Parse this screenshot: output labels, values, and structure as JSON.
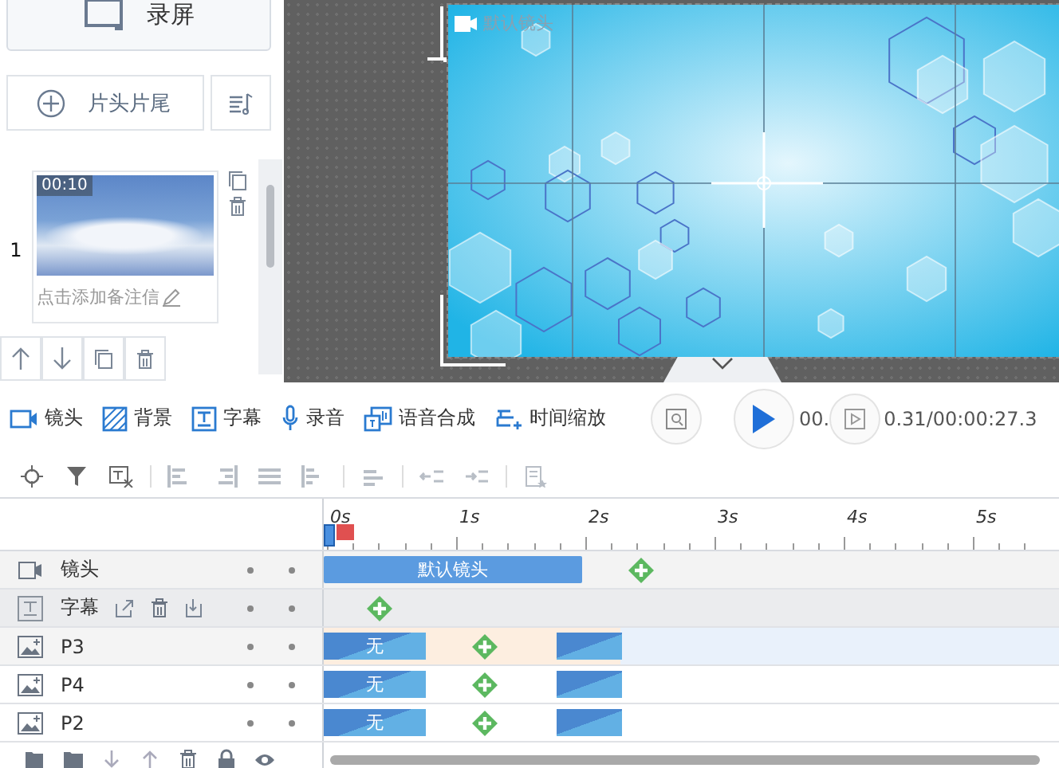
{
  "left_panel": {
    "record_button": "录屏",
    "intro_outro_button": "片头片尾",
    "scenes": [
      {
        "number": "1",
        "duration": "00:10",
        "note": "点击添加备注信"
      }
    ]
  },
  "preview": {
    "camera_label": "默认镜头"
  },
  "toolbar": [
    {
      "kind": "camera",
      "label": "镜头"
    },
    {
      "kind": "background",
      "label": "背景"
    },
    {
      "kind": "subtitle",
      "label": "字幕"
    },
    {
      "kind": "record",
      "label": "录音"
    },
    {
      "kind": "tts",
      "label": "语音合成"
    },
    {
      "kind": "zoom",
      "label": "时间缩放"
    }
  ],
  "playback": {
    "time_start": "00.",
    "time_rest": "0.31/00:00:27.3"
  },
  "timeline": {
    "ticks": [
      "0s",
      "1s",
      "2s",
      "3s",
      "4s",
      "5s"
    ],
    "tracks": [
      {
        "kind": "camera",
        "name": "镜头",
        "selected": false,
        "items": [
          {
            "kind": "bar",
            "label": "默认镜头"
          },
          {
            "kind": "add"
          }
        ]
      },
      {
        "kind": "subtitle",
        "name": "字幕",
        "selected": false,
        "items": [
          {
            "kind": "add"
          }
        ]
      },
      {
        "kind": "image",
        "name": "P3",
        "selected": true,
        "items": [
          {
            "kind": "transition",
            "label": "无"
          },
          {
            "kind": "add"
          },
          {
            "kind": "transition"
          }
        ]
      },
      {
        "kind": "image",
        "name": "P4",
        "selected": false,
        "items": [
          {
            "kind": "transition",
            "label": "无"
          },
          {
            "kind": "add"
          },
          {
            "kind": "transition"
          }
        ]
      },
      {
        "kind": "image",
        "name": "P2",
        "selected": false,
        "items": [
          {
            "kind": "transition",
            "label": "无"
          },
          {
            "kind": "add"
          },
          {
            "kind": "transition"
          }
        ]
      }
    ]
  }
}
